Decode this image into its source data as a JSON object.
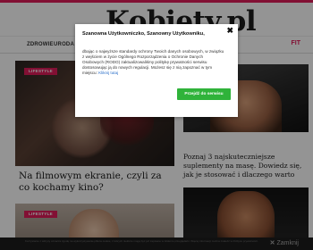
{
  "site": {
    "logo": "Kobiety.pl",
    "nav": [
      "ZDROWIE",
      "URODA"
    ],
    "nav_right": "FIT"
  },
  "articles": [
    {
      "tag": "LIFESTYLE",
      "title": "Na filmowym ekranie, czyli za co kochamy kino?"
    },
    {
      "title": "Poznaj 3 najskuteczniejsze suplementy na masę. Dowiedz się, jak je stosować i dlaczego warto"
    },
    {
      "tag": "LIFESTYLE"
    }
  ],
  "cookie_bar": {
    "text": "Korzystanie z witryny oznacza zgodę na wykorzystywanie plików cookie, z których niektóre mogą być już zapisane w folderze przeglądarki. Więcej informacji można znaleźć w Polityce prywatności.",
    "close_label": "Zamknij",
    "close_icon": "close-icon"
  },
  "modal": {
    "title": "Szanowna Użytkowniczko, Szanowny Użytkowniku,",
    "body": "dbając o najwyższe standardy ochrony Twoich danych osobowych, w związku z wejściem w życie Ogólnego Rozporządzenia o Ochronie Danych Osobowych (RODO) zaktualizowaliśmy politykę prywatności serwisu dostosowując ją do nowych regulacji. Możesz się z nią zapoznać w tym miejscu:",
    "link_label": "Kliknij tutaj",
    "button_label": "Przejdź do serwisu",
    "close_symbol": "✖",
    "accent_color": "#2fb33a"
  },
  "colors": {
    "brand": "#e11d5a",
    "link": "#2a6fc9"
  }
}
